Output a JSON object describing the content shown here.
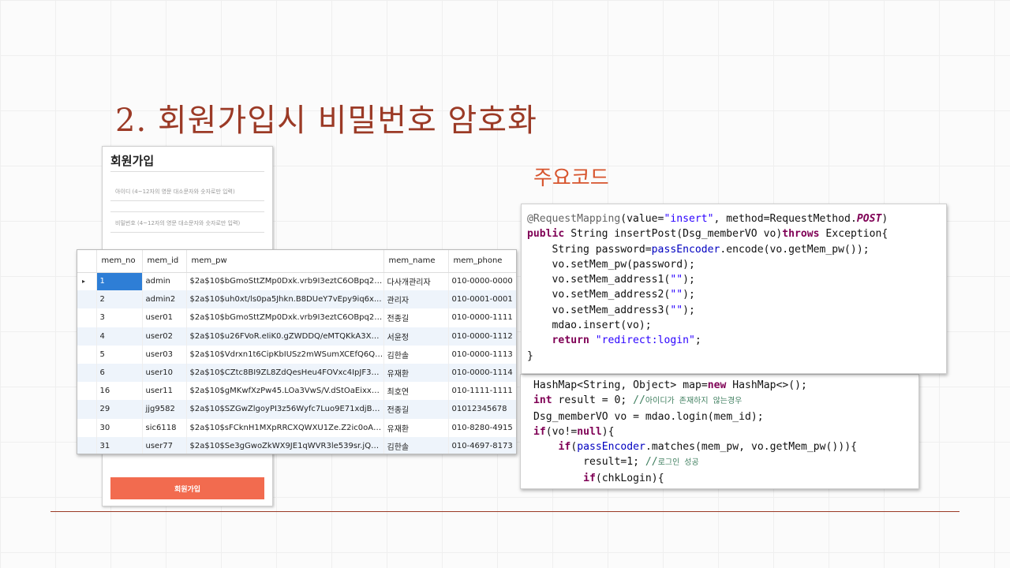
{
  "slide": {
    "title": "2. 회원가입시 비밀번호 암호화",
    "subtitle": "주요코드"
  },
  "signup": {
    "title": "회원가입",
    "id_placeholder": "아이디 (4~12자의 영문 대소문자와 숫자로만 입력)",
    "pw_placeholder": "비밀번호 (4~12자의 영문 대소문자와 숫자로만 입력)",
    "button_label": "회원가입"
  },
  "db_table": {
    "columns": [
      "mem_no",
      "mem_id",
      "mem_pw",
      "mem_name",
      "mem_phone"
    ],
    "row_indicator": "▸",
    "rows": [
      {
        "no": "1",
        "id": "admin",
        "pw": "$2a$10$bGmoSttZMp0Dxk.vrb9I3eztC6OBpq2F...",
        "name": "다사개관리자",
        "phone": "010-0000-0000"
      },
      {
        "no": "2",
        "id": "admin2",
        "pw": "$2a$10$uh0xt/ls0pa5Jhkn.B8DUeY7vEpy9iq6x...",
        "name": "관리자",
        "phone": "010-0001-0001"
      },
      {
        "no": "3",
        "id": "user01",
        "pw": "$2a$10$bGmoSttZMp0Dxk.vrb9I3eztC6OBpq2F...",
        "name": "전종길",
        "phone": "010-0000-1111"
      },
      {
        "no": "4",
        "id": "user02",
        "pw": "$2a$10$u26FVoR.eIiK0.gZWDDQ/eMTQKkA3Xd...",
        "name": "서윤정",
        "phone": "010-0000-1112"
      },
      {
        "no": "5",
        "id": "user03",
        "pw": "$2a$10$Vdrxn1t6CipKbIUSz2mWSumXCEfQ6Ql...",
        "name": "김한솔",
        "phone": "010-0000-1113"
      },
      {
        "no": "6",
        "id": "user10",
        "pw": "$2a$10$CZtc8BI9ZL8ZdQesHeu4FOVxc4IpJF3D...",
        "name": "유재환",
        "phone": "010-0000-1114"
      },
      {
        "no": "16",
        "id": "user11",
        "pw": "$2a$10$gMKwfXzPw45.LOa3VwS/V.dStOaEixx4...",
        "name": "최호연",
        "phone": "010-1111-1111"
      },
      {
        "no": "29",
        "id": "jjg9582",
        "pw": "$2a$10$SZGwZlgoyPI3z56Wyfc7Luo9E71xdjBH...",
        "name": "전종길",
        "phone": "01012345678"
      },
      {
        "no": "30",
        "id": "sic6118",
        "pw": "$2a$10$sFCknH1MXpRRCXQWXU1Ze.Z2ic0oAu...",
        "name": "유재환",
        "phone": "010-8280-4915"
      },
      {
        "no": "31",
        "id": "user77",
        "pw": "$2a$10$Se3gGwoZkWX9JE1qWVR3le539sr.jQ0...",
        "name": "김한솔",
        "phone": "010-4697-8173"
      }
    ]
  },
  "code1": {
    "l1_ann": "@RequestMapping",
    "l1_a": "(value=",
    "l1_str1": "\"insert\"",
    "l1_b": ", method=RequestMethod.",
    "l1_post": "POST",
    "l1_c": ")",
    "l2_kw1": "public",
    "l2_a": " String insertPost(Dsg_memberVO vo)",
    "l2_kw2": "throws",
    "l2_b": " Exception{",
    "l3_a": "    String password=",
    "l3_field": "passEncoder",
    "l3_b": ".encode(vo.getMem_pw());",
    "l4": "    vo.setMem_pw(password);",
    "l5_a": "    vo.setMem_address1(",
    "l5_str": "\"\"",
    "l5_b": ");",
    "l6_a": "    vo.setMem_address2(",
    "l6_str": "\"\"",
    "l6_b": ");",
    "l7_a": "    vo.setMem_address3(",
    "l7_str": "\"\"",
    "l7_b": ");",
    "l8": "    mdao.insert(vo);",
    "l9_a": "    ",
    "l9_kw": "return",
    "l9_b": " ",
    "l9_str": "\"redirect:login\"",
    "l9_c": ";",
    "l10": "}"
  },
  "code2": {
    "l1_a": "HashMap<String, Object> map=",
    "l1_kw": "new",
    "l1_b": " HashMap<>();",
    "l2_kw": "int",
    "l2_a": " result = 0; ",
    "l2_cmt1": "//",
    "l2_cmt2": "아이디가 존재하지 않는경우",
    "l3": "Dsg_memberVO vo = mdao.login(mem_id);",
    "l4_kw1": "if",
    "l4_a": "(vo!=",
    "l4_kw2": "null",
    "l4_b": "){",
    "l5_a": "    ",
    "l5_kw": "if",
    "l5_b": "(",
    "l5_field": "passEncoder",
    "l5_c": ".matches(mem_pw, vo.getMem_pw())){",
    "l6_a": "        result=1; ",
    "l6_cmt1": "//",
    "l6_cmt2": "로그인 성공",
    "l7_a": "        ",
    "l7_kw": "if",
    "l7_b": "(chkLogin){"
  }
}
